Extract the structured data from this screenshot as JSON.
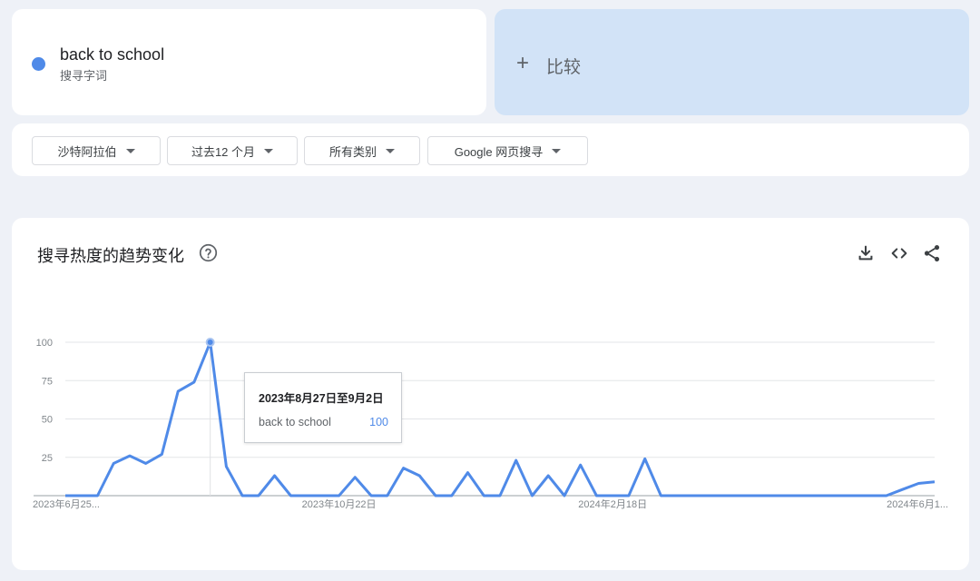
{
  "search_term": {
    "name": "back to school",
    "subtitle": "搜寻字词",
    "dot_color": "#4f8ae8"
  },
  "compare": {
    "plus": "+",
    "label": "比较",
    "background": "#d2e3f7"
  },
  "filters": [
    {
      "label": "沙特阿拉伯"
    },
    {
      "label": "过去12 个月"
    },
    {
      "label": "所有类别"
    },
    {
      "label": "Google 网页搜寻"
    }
  ],
  "chart_section": {
    "title": "搜寻热度的趋势变化",
    "help_icon": "help-circle-icon",
    "actions": [
      "download-icon",
      "embed-code-icon",
      "share-icon"
    ]
  },
  "chart_data": {
    "type": "line",
    "title": "",
    "xlabel": "",
    "ylabel": "",
    "ylim": [
      0,
      100
    ],
    "yticks": [
      25,
      50,
      75,
      100
    ],
    "grid": true,
    "x_tick_labels": [
      {
        "index": 0,
        "label": "2023年6月25..."
      },
      {
        "index": 17,
        "label": "2023年10月22日"
      },
      {
        "index": 34,
        "label": "2024年2月18日"
      },
      {
        "index": 51,
        "label": "2024年6月1..."
      }
    ],
    "series": [
      {
        "name": "back to school",
        "color": "#4f8ae8",
        "values": [
          0,
          0,
          0,
          21,
          26,
          21,
          27,
          68,
          74,
          100,
          19,
          0,
          0,
          13,
          0,
          0,
          0,
          0,
          12,
          0,
          0,
          18,
          13,
          0,
          0,
          15,
          0,
          0,
          23,
          0,
          13,
          0,
          20,
          0,
          0,
          0,
          24,
          0,
          0,
          0,
          0,
          0,
          0,
          0,
          0,
          0,
          0,
          0,
          0,
          0,
          0,
          0,
          4,
          8,
          9
        ]
      }
    ],
    "highlight_index": 9
  },
  "tooltip": {
    "date": "2023年8月27日至9月2日",
    "series": "back to school",
    "value": "100"
  }
}
